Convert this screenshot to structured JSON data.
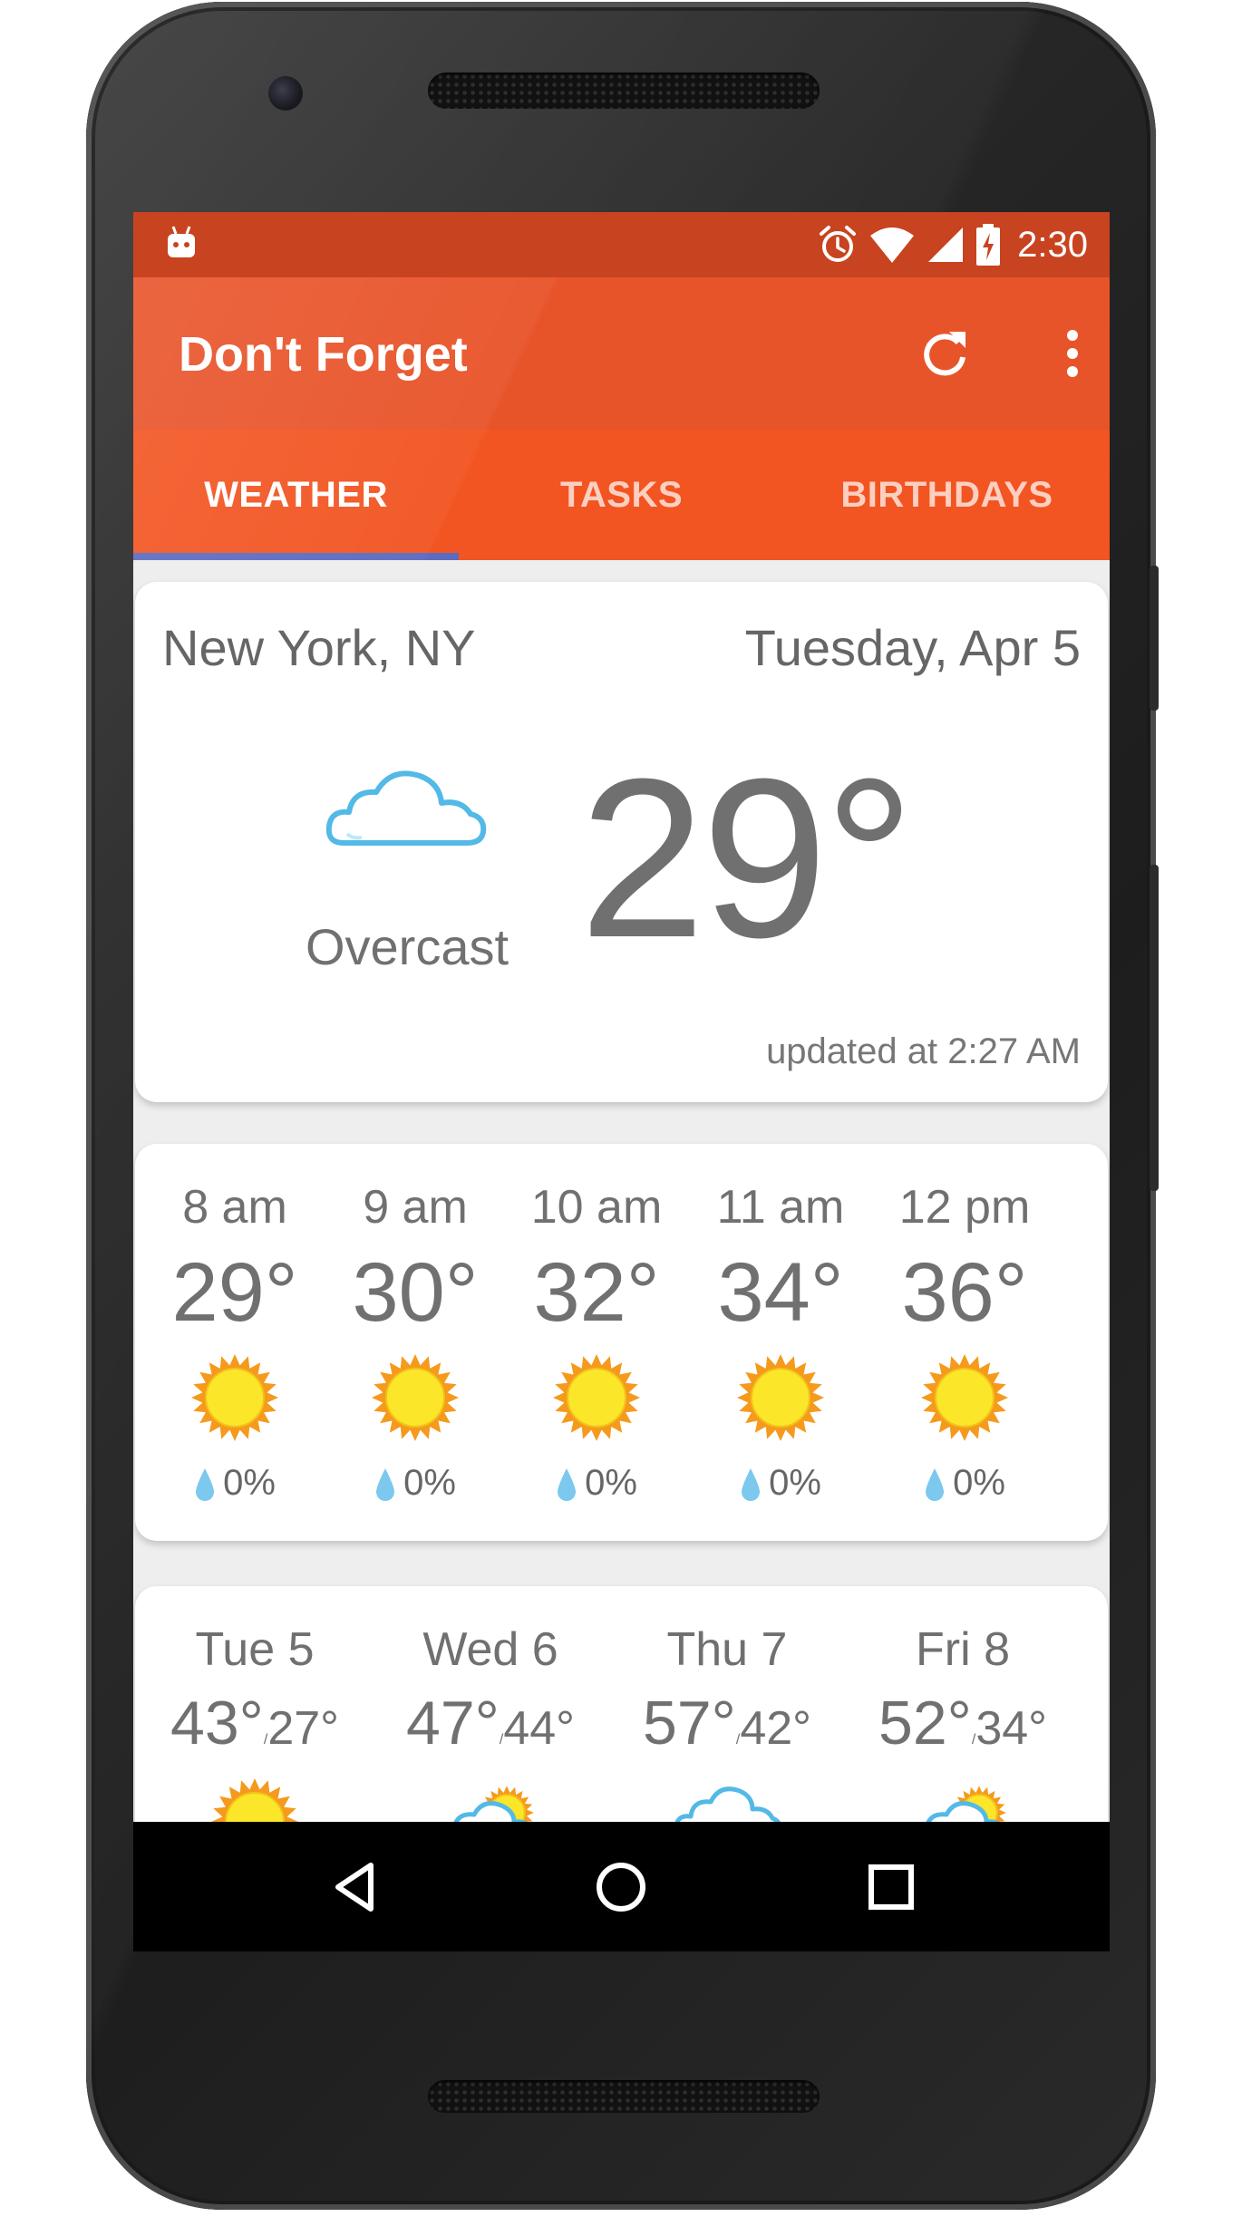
{
  "status_bar": {
    "time": "2:30",
    "icons": [
      "android-notification-icon",
      "alarm-icon",
      "wifi-icon",
      "cell-signal-icon",
      "battery-charging-icon"
    ]
  },
  "app_bar": {
    "title": "Don't Forget",
    "actions": [
      "refresh-icon",
      "more-vert-icon"
    ]
  },
  "tabs": [
    {
      "label": "WEATHER",
      "active": true
    },
    {
      "label": "TASKS",
      "active": false
    },
    {
      "label": "BIRTHDAYS",
      "active": false
    }
  ],
  "current": {
    "location": "New York, NY",
    "date": "Tuesday, Apr 5",
    "condition": "Overcast",
    "condition_icon": "cloud-icon",
    "temperature": "29°",
    "updated": "updated at 2:27 AM"
  },
  "hourly": [
    {
      "time": "8 am",
      "temp": "29°",
      "icon": "sun-icon",
      "precip": "0%"
    },
    {
      "time": "9 am",
      "temp": "30°",
      "icon": "sun-icon",
      "precip": "0%"
    },
    {
      "time": "10 am",
      "temp": "32°",
      "icon": "sun-icon",
      "precip": "0%"
    },
    {
      "time": "11 am",
      "temp": "34°",
      "icon": "sun-icon",
      "precip": "0%"
    },
    {
      "time": "12 pm",
      "temp": "36°",
      "icon": "sun-icon",
      "precip": "0%"
    }
  ],
  "daily": [
    {
      "day": "Tue 5",
      "high": "43°",
      "low": "27°",
      "icon": "sun-icon"
    },
    {
      "day": "Wed 6",
      "high": "47°",
      "low": "44°",
      "icon": "partly-cloudy-icon"
    },
    {
      "day": "Thu 7",
      "high": "57°",
      "low": "42°",
      "icon": "cloud-icon"
    },
    {
      "day": "Fri 8",
      "high": "52°",
      "low": "34°",
      "icon": "partly-cloudy-icon"
    }
  ],
  "nav_bar": [
    "back-icon",
    "home-icon",
    "recents-icon"
  ],
  "colors": {
    "status_bar": "#c8431f",
    "app_bar": "#e8542a",
    "tabs": "#f25522",
    "tab_indicator": "#5c6bc0"
  }
}
